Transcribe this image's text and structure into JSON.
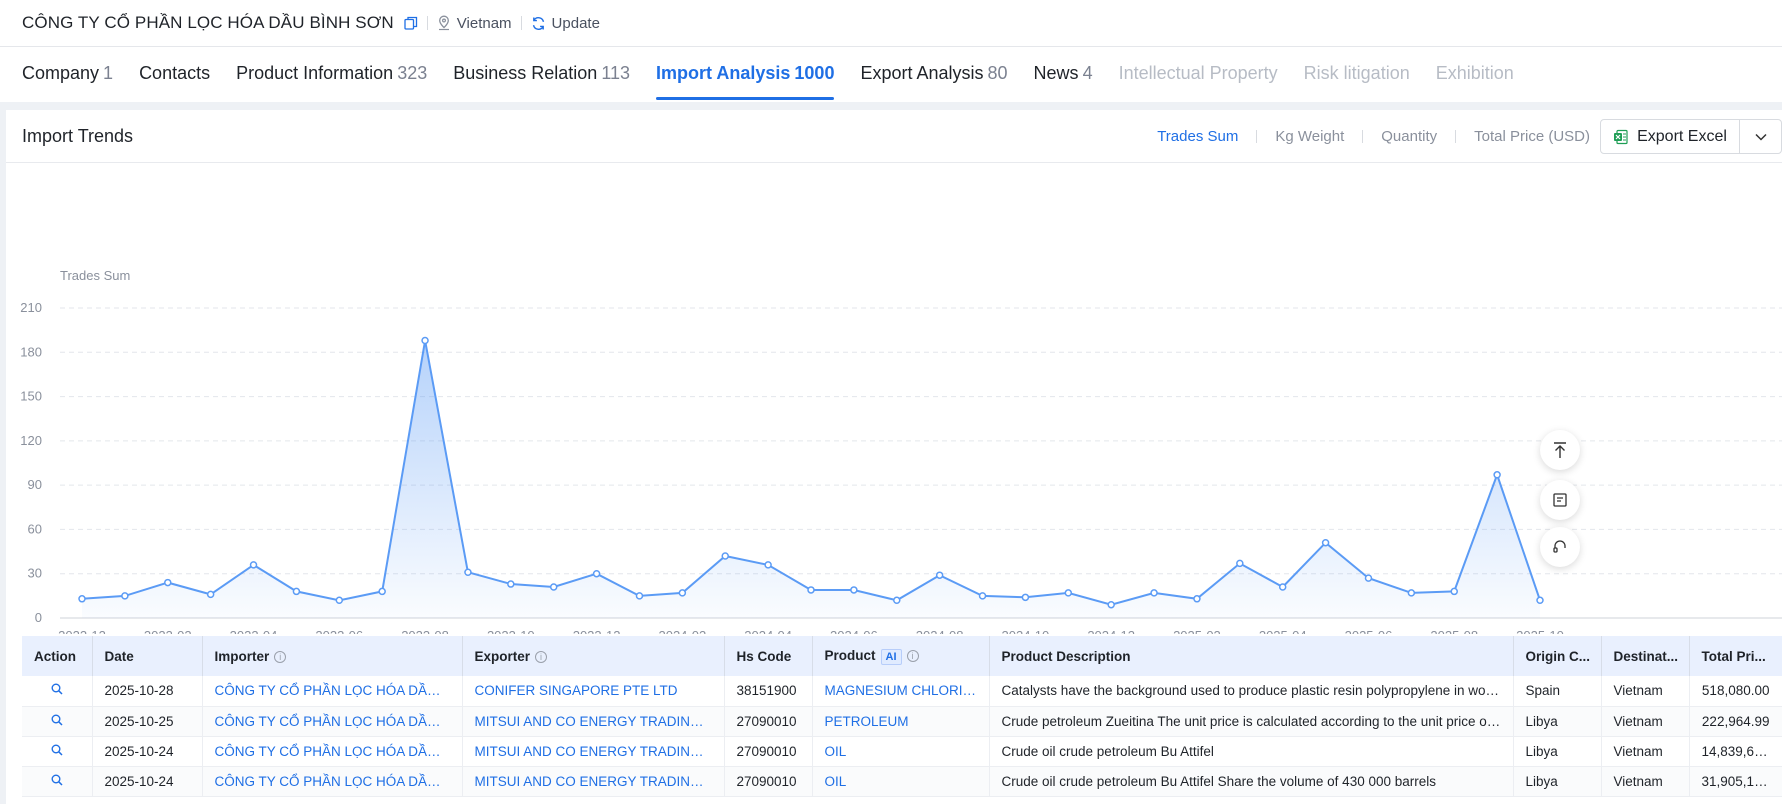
{
  "header": {
    "company_name": "CÔNG TY CỔ PHẦN LỌC HÓA DẦU BÌNH SƠN",
    "country": "Vietnam",
    "update_label": "Update"
  },
  "tabs": [
    {
      "label": "Company",
      "count": "1"
    },
    {
      "label": "Contacts",
      "count": ""
    },
    {
      "label": "Product Information",
      "count": "323"
    },
    {
      "label": "Business Relation",
      "count": "113"
    },
    {
      "label": "Import Analysis",
      "count": "1000"
    },
    {
      "label": "Export Analysis",
      "count": "80"
    },
    {
      "label": "News",
      "count": "4"
    },
    {
      "label": "Intellectual Property",
      "count": ""
    },
    {
      "label": "Risk litigation",
      "count": ""
    },
    {
      "label": "Exhibition",
      "count": ""
    }
  ],
  "panel": {
    "title": "Import Trends",
    "metrics": [
      "Trades Sum",
      "Kg Weight",
      "Quantity",
      "Total Price (USD)"
    ],
    "active_metric": "Trades Sum",
    "export_label": "Export Excel"
  },
  "colors": {
    "accent": "#1f6fe5",
    "line": "#5b9bf5",
    "header_bg": "#e9f0fe"
  },
  "chart_data": {
    "type": "area",
    "ylabel": "Trades Sum",
    "ylim": [
      0,
      210
    ],
    "yticks": [
      0,
      30,
      60,
      90,
      120,
      150,
      180,
      210
    ],
    "x": [
      "2022-12",
      "2023-01",
      "2023-02",
      "2023-03",
      "2023-04",
      "2023-05",
      "2023-06",
      "2023-07",
      "2023-08",
      "2023-09",
      "2023-10",
      "2023-11",
      "2023-12",
      "2024-01",
      "2024-02",
      "2024-03",
      "2024-04",
      "2024-05",
      "2024-06",
      "2024-07",
      "2024-08",
      "2024-09",
      "2024-10",
      "2024-11",
      "2024-12",
      "2025-01",
      "2025-02",
      "2025-03",
      "2025-04",
      "2025-05",
      "2025-06",
      "2025-07",
      "2025-08",
      "2025-09",
      "2025-10"
    ],
    "xticks": [
      "2022-12",
      "2023-02",
      "2023-04",
      "2023-06",
      "2023-08",
      "2023-10",
      "2023-12",
      "2024-02",
      "2024-04",
      "2024-06",
      "2024-08",
      "2024-10",
      "2024-12",
      "2025-02",
      "2025-04",
      "2025-06",
      "2025-08",
      "2025-10"
    ],
    "values": [
      13,
      15,
      24,
      16,
      36,
      18,
      12,
      18,
      188,
      31,
      23,
      21,
      30,
      15,
      17,
      42,
      36,
      19,
      19,
      12,
      29,
      15,
      14,
      17,
      9,
      17,
      13,
      37,
      21,
      51,
      27,
      17,
      18,
      97,
      12
    ],
    "grid": true,
    "legend": "none"
  },
  "table": {
    "columns": [
      "Action",
      "Date",
      "Importer",
      "Exporter",
      "Hs Code",
      "Product",
      "Product Description",
      "Origin C...",
      "Destinat...",
      "Total Pri..."
    ],
    "ai_label": "AI",
    "rows": [
      {
        "date": "2025-10-28",
        "importer": "CÔNG TY CỔ PHẦN LỌC HÓA DẦU BÌNH SƠN",
        "exporter": "CONIFER SINGAPORE PTE LTD",
        "hs": "38151900",
        "product": "MAGNESIUM CHLORIDE",
        "desc": "Catalysts have the background used to produce plastic resin polypropylene in work...",
        "origin": "Spain",
        "dest": "Vietnam",
        "price": "518,080.00"
      },
      {
        "date": "2025-10-25",
        "importer": "CÔNG TY CỔ PHẦN LỌC HÓA DẦU BÌNH SƠN",
        "exporter": "MITSUI AND CO ENERGY TRADING SINGAPORE",
        "hs": "27090010",
        "product": "PETROLEUM",
        "desc": "Crude petroleum Zueitina The unit price is calculated according to the unit price of c...",
        "origin": "Libya",
        "dest": "Vietnam",
        "price": "222,964.99"
      },
      {
        "date": "2025-10-24",
        "importer": "CÔNG TY CỔ PHẦN LỌC HÓA DẦU BÌNH SƠN",
        "exporter": "MITSUI AND CO ENERGY TRADING SINGAPORE",
        "hs": "27090010",
        "product": "OIL",
        "desc": "Crude oil crude petroleum Bu Attifel",
        "origin": "Libya",
        "dest": "Vietnam",
        "price": "14,839,60..."
      },
      {
        "date": "2025-10-24",
        "importer": "CÔNG TY CỔ PHẦN LỌC HÓA DẦU BÌNH SƠN",
        "exporter": "MITSUI AND CO ENERGY TRADING SINGAPORE",
        "hs": "27090010",
        "product": "OIL",
        "desc": "Crude oil crude petroleum Bu Attifel Share the volume of 430 000 barrels",
        "origin": "Libya",
        "dest": "Vietnam",
        "price": "31,905,14..."
      }
    ]
  }
}
